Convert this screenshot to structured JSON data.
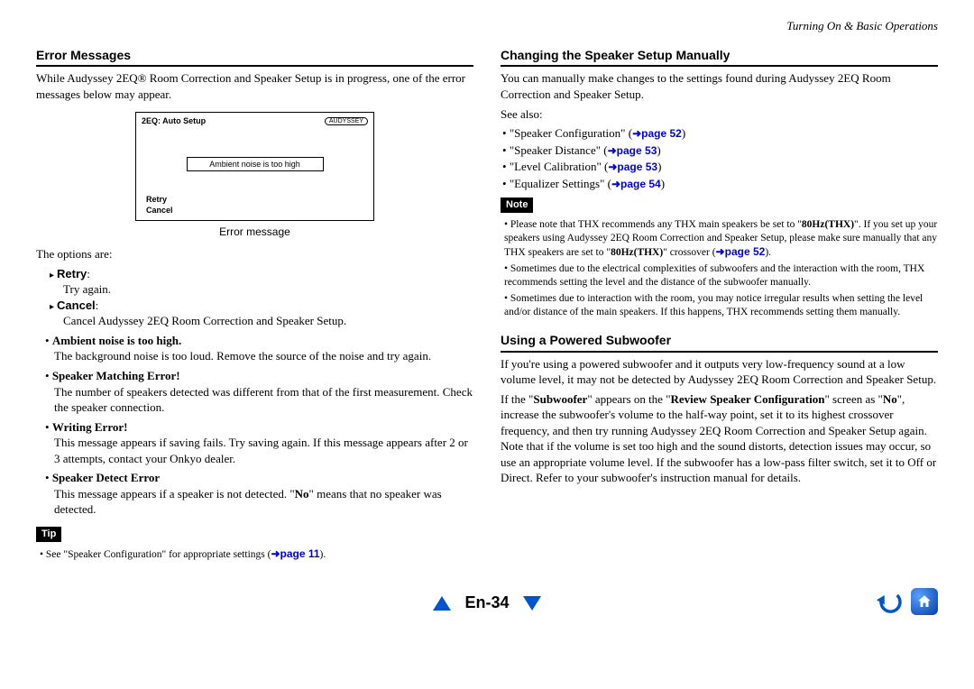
{
  "header": {
    "section_label": "Turning On & Basic Operations"
  },
  "left": {
    "h_error": "Error Messages",
    "intro": "While Audyssey 2EQ® Room Correction and Speaker Setup is in progress, one of the error messages below may appear.",
    "diagram": {
      "title": "2EQ: Auto Setup",
      "badge": "AUDYSSEY",
      "msg": "Ambient noise is too high",
      "retry": "Retry",
      "cancel": "Cancel",
      "caption": "Error message"
    },
    "options_intro": "The options are:",
    "opt1_label": "Retry",
    "opt1_desc": "Try again.",
    "opt2_label": "Cancel",
    "opt2_desc": "Cancel Audyssey 2EQ Room Correction and Speaker Setup.",
    "err1_label": "Ambient noise is too high.",
    "err1_desc": "The background noise is too loud. Remove the source of the noise and try again.",
    "err2_label": "Speaker Matching Error!",
    "err2_desc": "The number of speakers detected was different from that of the first measurement. Check the speaker connection.",
    "err3_label": "Writing Error!",
    "err3_desc": "This message appears if saving fails. Try saving again. If this message appears after 2 or 3 attempts, contact your Onkyo dealer.",
    "err4_label": "Speaker Detect Error",
    "err4_desc_a": "This message appears if a speaker is not detected. \"",
    "err4_desc_b": "No",
    "err4_desc_c": "\" means that no speaker was detected.",
    "tip_label": "Tip",
    "tip_text_a": "See \"Speaker Configuration\" for appropriate settings (",
    "tip_link": "page 11",
    "tip_text_b": ")."
  },
  "right": {
    "h_change": "Changing the Speaker Setup Manually",
    "change_intro": "You can manually make changes to the settings found during Audyssey 2EQ Room Correction and Speaker Setup.",
    "see_also": "See also:",
    "ref1_a": "\"Speaker Configuration\" (",
    "ref1_link": "page 52",
    "ref1_b": ")",
    "ref2_a": "\"Speaker Distance\" (",
    "ref2_link": "page 53",
    "ref2_b": ")",
    "ref3_a": "\"Level Calibration\" (",
    "ref3_link": "page 53",
    "ref3_b": ")",
    "ref4_a": "\"Equalizer Settings\" (",
    "ref4_link": "page 54",
    "ref4_b": ")",
    "note_label": "Note",
    "note1_a": "Please note that THX recommends any THX main speakers be set to \"",
    "note1_b": "80Hz(THX)",
    "note1_c": "\". If you set up your speakers using Audyssey 2EQ Room Correction and Speaker Setup, please make sure manually that any THX speakers are set to \"",
    "note1_d": "80Hz(THX)",
    "note1_e": "\" crossover (",
    "note1_link": "page 52",
    "note1_f": ").",
    "note2": "Sometimes due to the electrical complexities of subwoofers and the interaction with the room, THX recommends setting the level and the distance of the subwoofer manually.",
    "note3": "Sometimes due to interaction with the room, you may notice irregular results when setting the level and/or distance of the main speakers. If this happens, THX recommends setting them manually.",
    "h_sub": "Using a Powered Subwoofer",
    "sub_p1": "If you're using a powered subwoofer and it outputs very low-frequency sound at a low volume level, it may not be detected by Audyssey 2EQ Room Correction and Speaker Setup.",
    "sub_p2_a": "If the \"",
    "sub_p2_b": "Subwoofer",
    "sub_p2_c": "\" appears on the \"",
    "sub_p2_d": "Review Speaker Configuration",
    "sub_p2_e": "\" screen as \"",
    "sub_p2_f": "No",
    "sub_p2_g": "\", increase the subwoofer's volume to the half-way point, set it to its highest crossover frequency, and then try running Audyssey 2EQ Room Correction and Speaker Setup again. Note that if the volume is set too high and the sound distorts, detection issues may occur, so use an appropriate volume level. If the subwoofer has a low-pass filter switch, set it to Off or Direct. Refer to your subwoofer's instruction manual for details."
  },
  "footer": {
    "page": "En-34"
  }
}
